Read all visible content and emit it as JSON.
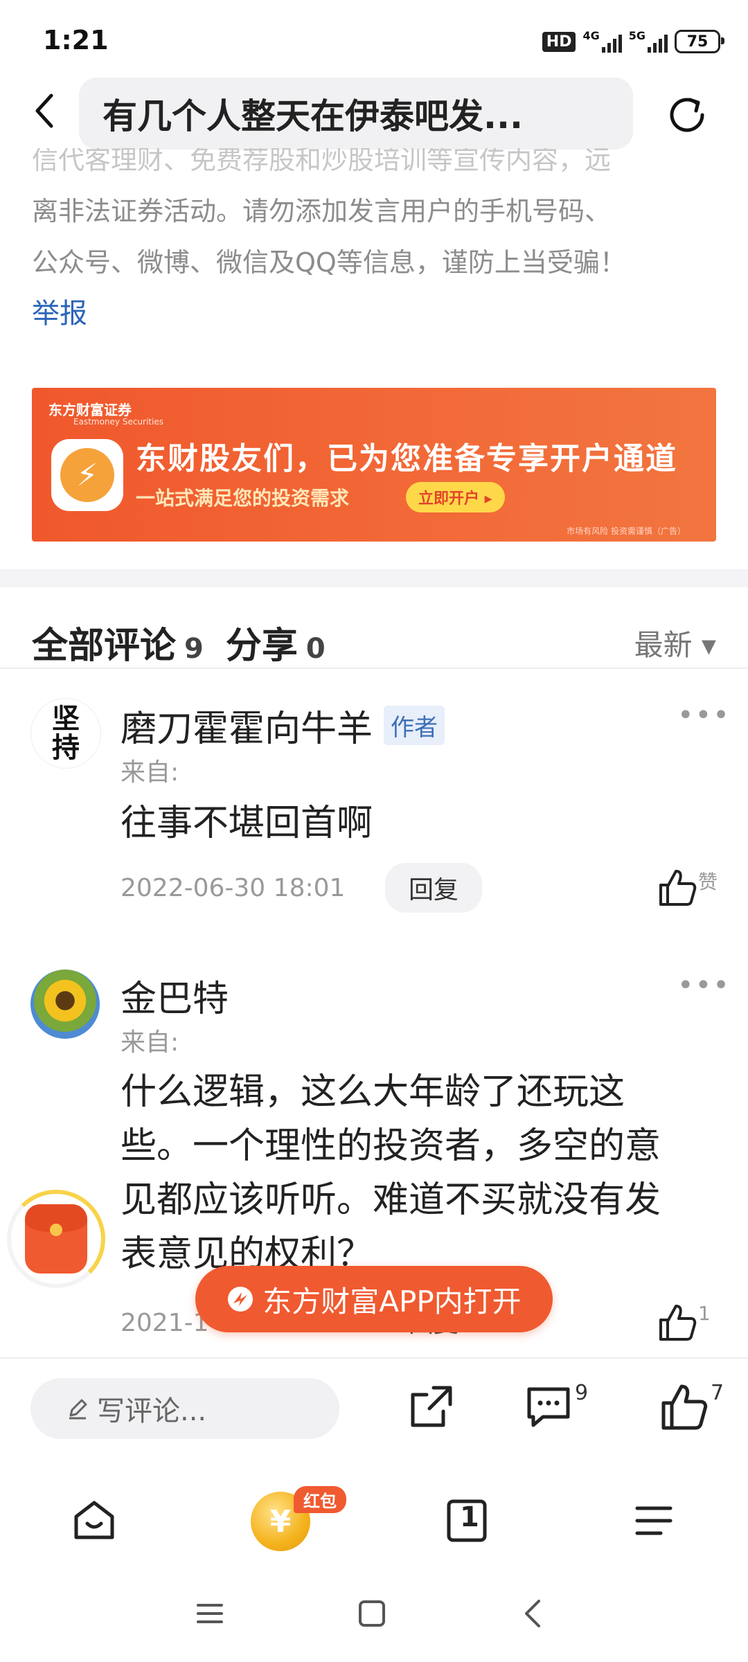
{
  "status_bar": {
    "time": "1:21",
    "hd": "HD",
    "net1": "4G",
    "net2": "5G",
    "battery": "75"
  },
  "header": {
    "title": "有几个人整天在伊泰吧发..."
  },
  "notice": {
    "faded_line": "信代客理财、免费荐股和炒股培训等宣传内容，远",
    "lines": [
      "离非法证券活动。请勿添加发言用户的手机号码、",
      "公众号、微博、微信及QQ等信息，谨防上当受骗！"
    ],
    "report": "举报"
  },
  "ad": {
    "brand": "东方财富证券",
    "brand_sub": "Eastmoney Securities",
    "headline": "东财股友们，已为您准备专享开户通道",
    "subline": "一站式满足您的投资需求",
    "cta": "立即开户 ▸",
    "footnote": "市场有风险 投资需谨慎（广告）"
  },
  "comments_header": {
    "all_label": "全部评论",
    "all_count": "9",
    "share_label": "分享",
    "share_count": "0",
    "sort": "最新 ▾"
  },
  "comments": [
    {
      "avatar_text": [
        "坚",
        "持"
      ],
      "user": "磨刀霍霍向牛羊",
      "tag": "作者",
      "from": "来自:",
      "text": "往事不堪回首啊",
      "date": "2022-06-30 18:01",
      "reply": "回复",
      "like_label": "赞"
    },
    {
      "user": "金巴特",
      "from": "来自:",
      "text_lines": [
        "什么逻辑，这么大年龄了还玩这",
        "些。一个理性的投资者，多空的意",
        "见都应该听听。难道不买就没有发",
        "表意见的权利？"
      ],
      "date": "2021-1",
      "reply": "回复",
      "like_count": "1"
    }
  ],
  "floating": {
    "open_app": "东方财富APP内打开"
  },
  "bottom_bar": {
    "write_placeholder": "写评论...",
    "comment_count": "9",
    "like_count": "7"
  },
  "app_nav": {
    "hongbao": "红包",
    "coin": "¥",
    "tab_count": "1"
  }
}
